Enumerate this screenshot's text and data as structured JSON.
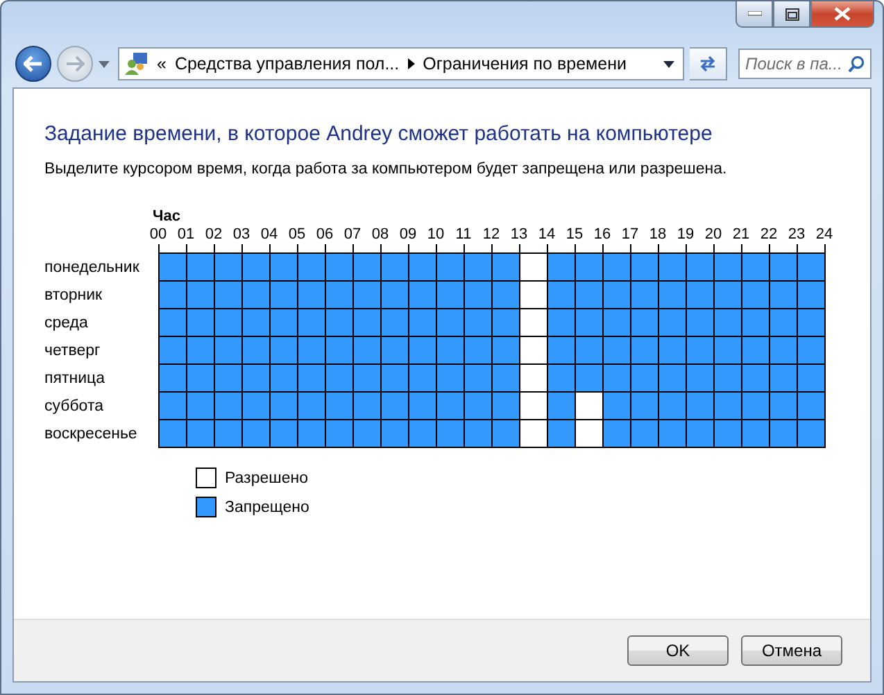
{
  "address_bar": {
    "overflow": "«",
    "breadcrumbs": [
      "Средства управления пол...",
      "Ограничения по времени"
    ]
  },
  "search": {
    "placeholder": "Поиск в па..."
  },
  "heading": "Задание времени, в которое Andrey сможет работать на компьютере",
  "instruction": "Выделите курсором время, когда работа за компьютером будет запрещена или разрешена.",
  "hour_caption": "Час",
  "hours": [
    "00",
    "01",
    "02",
    "03",
    "04",
    "05",
    "06",
    "07",
    "08",
    "09",
    "10",
    "11",
    "12",
    "13",
    "14",
    "15",
    "16",
    "17",
    "18",
    "19",
    "20",
    "21",
    "22",
    "23",
    "24"
  ],
  "days": [
    {
      "name": "понедельник",
      "allowed": [
        false,
        false,
        false,
        false,
        false,
        false,
        false,
        false,
        false,
        false,
        false,
        false,
        false,
        true,
        false,
        false,
        false,
        false,
        false,
        false,
        false,
        false,
        false,
        false
      ]
    },
    {
      "name": "вторник",
      "allowed": [
        false,
        false,
        false,
        false,
        false,
        false,
        false,
        false,
        false,
        false,
        false,
        false,
        false,
        true,
        false,
        false,
        false,
        false,
        false,
        false,
        false,
        false,
        false,
        false
      ]
    },
    {
      "name": "среда",
      "allowed": [
        false,
        false,
        false,
        false,
        false,
        false,
        false,
        false,
        false,
        false,
        false,
        false,
        false,
        true,
        false,
        false,
        false,
        false,
        false,
        false,
        false,
        false,
        false,
        false
      ]
    },
    {
      "name": "четверг",
      "allowed": [
        false,
        false,
        false,
        false,
        false,
        false,
        false,
        false,
        false,
        false,
        false,
        false,
        false,
        true,
        false,
        false,
        false,
        false,
        false,
        false,
        false,
        false,
        false,
        false
      ]
    },
    {
      "name": "пятница",
      "allowed": [
        false,
        false,
        false,
        false,
        false,
        false,
        false,
        false,
        false,
        false,
        false,
        false,
        false,
        true,
        false,
        false,
        false,
        false,
        false,
        false,
        false,
        false,
        false,
        false
      ]
    },
    {
      "name": "суббота",
      "allowed": [
        false,
        false,
        false,
        false,
        false,
        false,
        false,
        false,
        false,
        false,
        false,
        false,
        false,
        true,
        false,
        true,
        false,
        false,
        false,
        false,
        false,
        false,
        false,
        false
      ]
    },
    {
      "name": "воскресенье",
      "allowed": [
        false,
        false,
        false,
        false,
        false,
        false,
        false,
        false,
        false,
        false,
        false,
        false,
        false,
        true,
        false,
        true,
        false,
        false,
        false,
        false,
        false,
        false,
        false,
        false
      ]
    }
  ],
  "legend": [
    {
      "kind": "allowed",
      "label": "Разрешено"
    },
    {
      "kind": "blocked",
      "label": "Запрещено"
    }
  ],
  "buttons": [
    "OK",
    "Отмена"
  ]
}
